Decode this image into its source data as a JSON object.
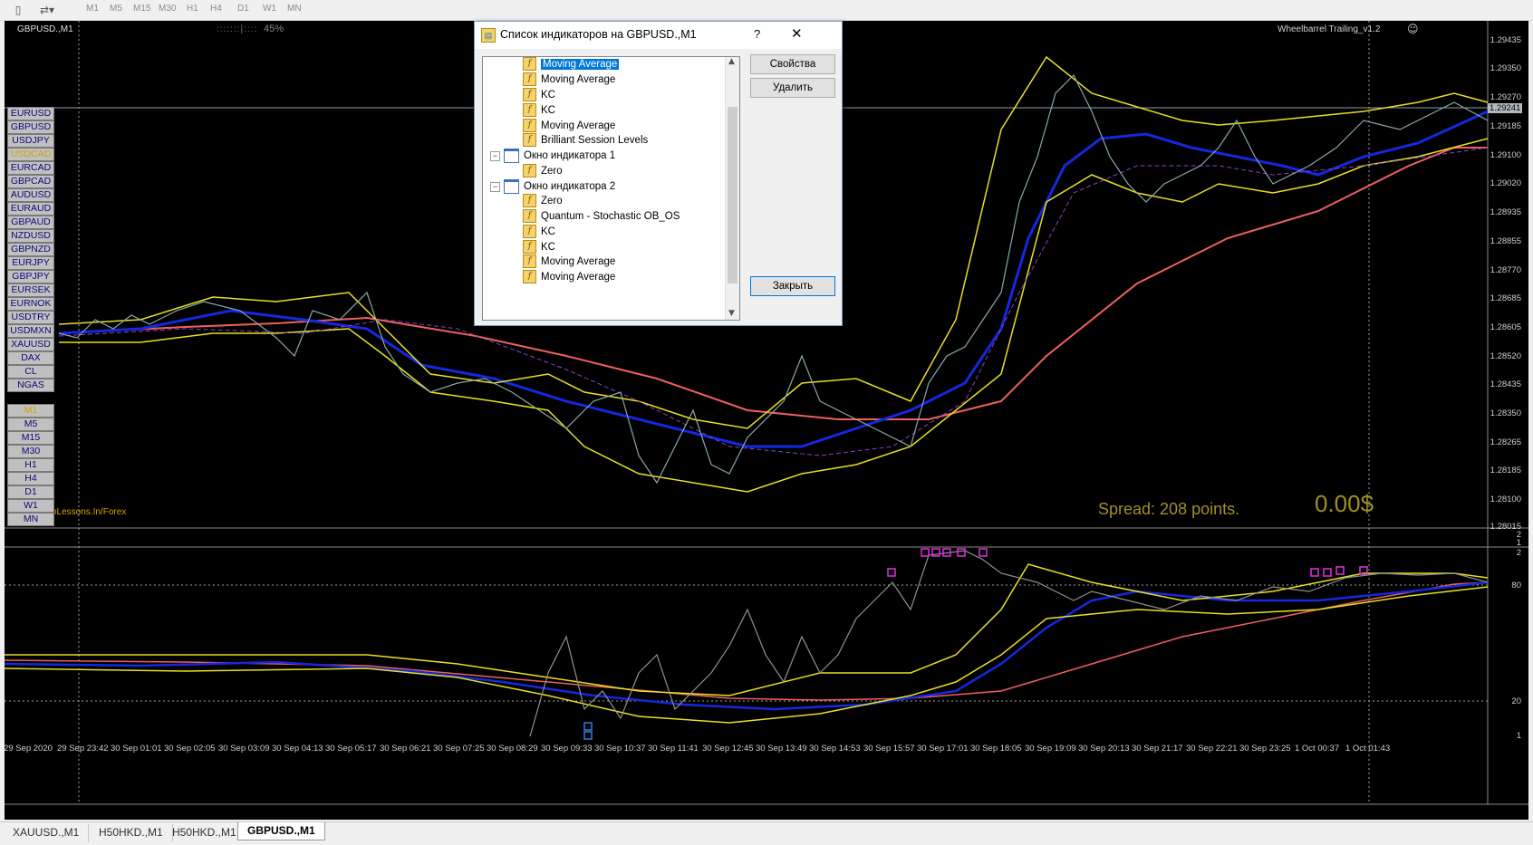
{
  "toolbar": {
    "timeframes": [
      "M1",
      "M5",
      "M15",
      "M30",
      "H1",
      "H4",
      "D1",
      "W1",
      "MN"
    ]
  },
  "chart": {
    "title": "GBPUSD.,M1",
    "progress_text": "45%",
    "ea_label": "Wheelbarrel Trailing_v1.2",
    "ea_icon": "smiley-icon",
    "spread_text": "Spread: 208 points.",
    "profit_text": "0.00$",
    "watermark_text": "oLessons.In/Forex",
    "current_price": "1.29241",
    "price_labels": [
      "1.29435",
      "1.29350",
      "1.29270",
      "1.29185",
      "1.29100",
      "1.29020",
      "1.28935",
      "1.28855",
      "1.28770",
      "1.28685",
      "1.28605",
      "1.28520",
      "1.28435",
      "1.28350",
      "1.28265",
      "1.28185",
      "1.28100",
      "1.28015"
    ],
    "sub_labels": [
      "2",
      "80",
      "20",
      "1"
    ],
    "sub_top_labels": [
      "2",
      "1"
    ],
    "time_labels": [
      "29 Sep 2020",
      "29 Sep 23:42",
      "30 Sep 01:01",
      "30 Sep 02:05",
      "30 Sep 03:09",
      "30 Sep 04:13",
      "30 Sep 05:17",
      "30 Sep 06:21",
      "30 Sep 07:25",
      "30 Sep 08:29",
      "30 Sep 09:33",
      "30 Sep 10:37",
      "30 Sep 11:41",
      "30 Sep 12:45",
      "30 Sep 13:49",
      "30 Sep 14:53",
      "30 Sep 15:57",
      "30 Sep 17:01",
      "30 Sep 18:05",
      "30 Sep 19:09",
      "30 Sep 20:13",
      "30 Sep 21:17",
      "30 Sep 22:21",
      "30 Sep 23:25",
      "1 Oct 00:37",
      "1 Oct 01:43"
    ],
    "symbols": [
      "EURUSD",
      "GBPUSD",
      "USDJPY",
      "USDCAD",
      "EURCAD",
      "GBPCAD",
      "AUDUSD",
      "EURAUD",
      "GBPAUD",
      "NZDUSD",
      "GBPNZD",
      "EURJPY",
      "GBPJPY",
      "EURSEK",
      "EURNOK",
      "USDTRY",
      "USDMXN",
      "XAUUSD",
      "DAX",
      "CL",
      "NGAS"
    ],
    "active_symbol_index": 3,
    "tf_buttons": [
      "M1",
      "M5",
      "M15",
      "M30",
      "H1",
      "H4",
      "D1",
      "W1",
      "MN"
    ],
    "active_tf_index": 0,
    "colors": {
      "ma_blue": "#1428e0",
      "ma_red": "#f06060",
      "kc_yellow": "#e8e020",
      "kc_dash": "#9040c8",
      "price": "#8aa8a8",
      "spread": "#a09028",
      "stoch_gray": "#909090",
      "marker": "#e030e0"
    }
  },
  "dialog": {
    "title": "Список индикаторов на GBPUSD.,M1",
    "help_label": "?",
    "close_label": "✕",
    "nodes": [
      {
        "label": "Moving Average",
        "type": "fx",
        "depth": 2,
        "selected": true
      },
      {
        "label": "Moving Average",
        "type": "fx",
        "depth": 2
      },
      {
        "label": "KC",
        "type": "fx",
        "depth": 2
      },
      {
        "label": "KC",
        "type": "fx",
        "depth": 2
      },
      {
        "label": "Moving Average",
        "type": "fx",
        "depth": 2
      },
      {
        "label": "Brilliant Session Levels",
        "type": "fx",
        "depth": 2
      },
      {
        "label": "Окно индикатора 1",
        "type": "win",
        "depth": 1
      },
      {
        "label": "Zero",
        "type": "fx",
        "depth": 2
      },
      {
        "label": "Окно индикатора 2",
        "type": "win",
        "depth": 1
      },
      {
        "label": "Zero",
        "type": "fx",
        "depth": 2
      },
      {
        "label": "Quantum - Stochastic OB_OS",
        "type": "fx",
        "depth": 2
      },
      {
        "label": "KC",
        "type": "fx",
        "depth": 2
      },
      {
        "label": "KC",
        "type": "fx",
        "depth": 2
      },
      {
        "label": "Moving Average",
        "type": "fx",
        "depth": 2
      },
      {
        "label": "Moving Average",
        "type": "fx",
        "depth": 2
      }
    ],
    "buttons": {
      "properties": "Свойства",
      "delete": "Удалить",
      "close": "Закрыть"
    }
  },
  "tabs": [
    {
      "label": "XAUUSD.,M1"
    },
    {
      "label": "H50HKD.,M1"
    },
    {
      "label": "H50HKD.,M1"
    },
    {
      "label": "GBPUSD.,M1",
      "active": true
    }
  ]
}
